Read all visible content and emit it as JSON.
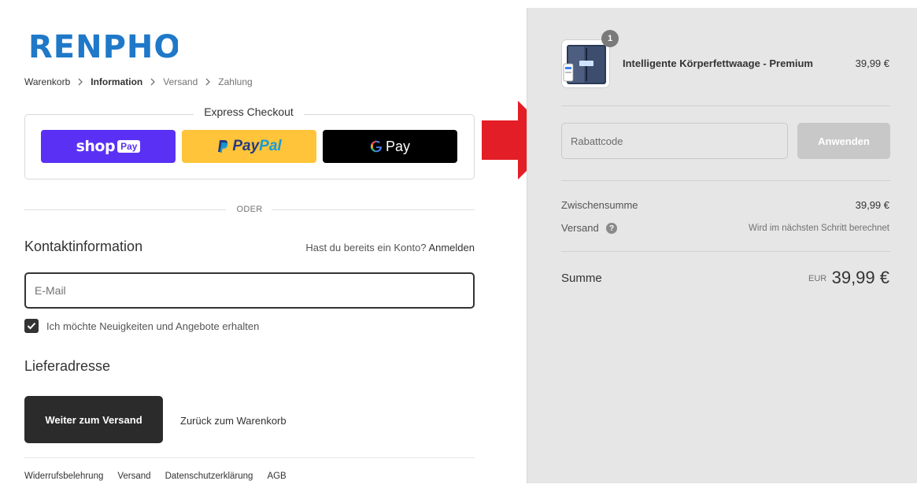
{
  "brand": {
    "logo_text": "RENPHO",
    "logo_color": "#1f78c8"
  },
  "breadcrumb": [
    {
      "label": "Warenkorb",
      "state": "link"
    },
    {
      "label": "Information",
      "state": "current"
    },
    {
      "label": "Versand",
      "state": "upcoming"
    },
    {
      "label": "Zahlung",
      "state": "upcoming"
    }
  ],
  "express": {
    "title": "Express Checkout",
    "shoppay_label": "shop",
    "shoppay_badge": "Pay",
    "paypal_label_a": "Pay",
    "paypal_label_b": "Pal",
    "gpay_label": "Pay"
  },
  "divider": {
    "label": "ODER"
  },
  "contact": {
    "title": "Kontaktinformation",
    "login_prompt": "Hast du bereits ein Konto?",
    "login_link": "Anmelden",
    "email_placeholder": "E-Mail",
    "newsletter_label": "Ich möchte Neuigkeiten und Angebote erhalten",
    "newsletter_checked": true
  },
  "shipping": {
    "title": "Lieferadresse"
  },
  "actions": {
    "continue_label": "Weiter zum Versand",
    "back_label": "Zurück zum Warenkorb"
  },
  "footer": {
    "links": [
      "Widerrufsbelehrung",
      "Versand",
      "Datenschutzerklärung",
      "AGB"
    ]
  },
  "order": {
    "product_name": "Intelligente Körperfettwaage - Premium",
    "product_price": "39,99 €",
    "quantity": "1",
    "discount_placeholder": "Rabattcode",
    "apply_label": "Anwenden",
    "subtotal_label": "Zwischensumme",
    "subtotal_value": "39,99 €",
    "shipping_label": "Versand",
    "shipping_value": "Wird im nächsten Schritt berechnet",
    "total_label": "Summe",
    "total_currency": "EUR",
    "total_value": "39,99 €"
  },
  "colors": {
    "shoppay": "#5a31f4",
    "paypal": "#ffc439",
    "gpay": "#000000",
    "primary_button": "#2b2b2b",
    "sidebar_bg": "#e6e6e6",
    "annotation_arrow": "#e41e26"
  }
}
